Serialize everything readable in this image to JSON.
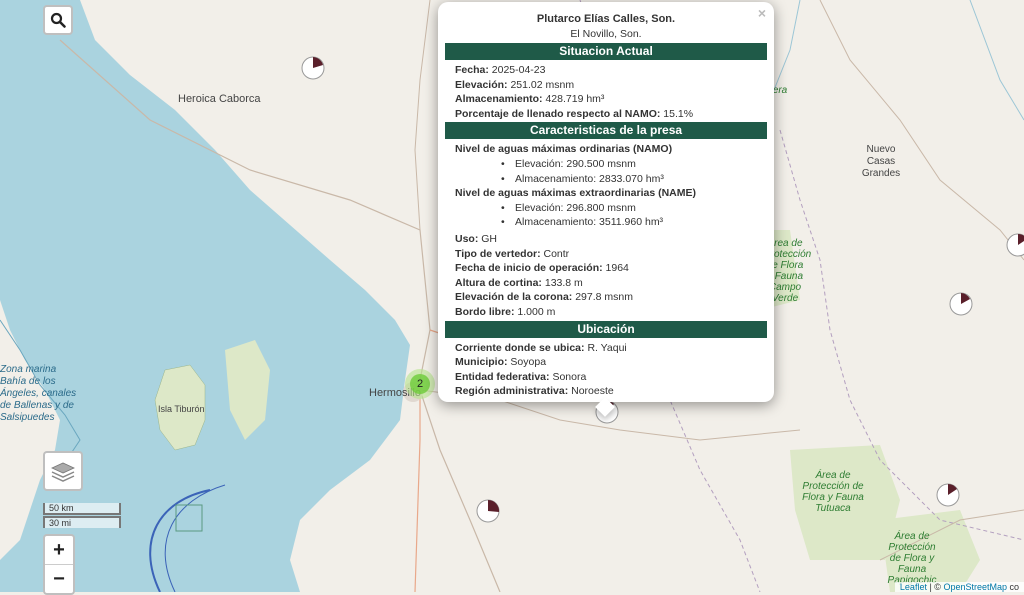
{
  "map": {
    "places": {
      "caborca": "Heroica Caborca",
      "hermosillo": "Hermosillo",
      "isla_tiburon": "Isla Tiburón",
      "nuevo_casas_grandes": "Nuevo Casas Grandes",
      "sea_area": "Zona marina Bahía de los Ángeles, canales de Ballenas y de Salsipuedes",
      "area_protegida_1": "Área de Protección de Flora y Fauna Campo Verde",
      "area_protegida_2": "Área de Protección de Flora y Fauna Tutuaca",
      "area_protegida_3": "Área de Protección de Flora y Fauna Papigochic",
      "partial_label": "fera"
    },
    "cluster_count": "2",
    "scale_km": "50 km",
    "scale_mi": "30 mi",
    "zoom_in": "+",
    "zoom_out": "−",
    "attribution_leaflet": "Leaflet",
    "attribution_sep": " | © ",
    "attribution_osm": "OpenStreetMap",
    "attribution_tail": " co",
    "icons": [
      "search-icon",
      "layers-icon"
    ],
    "colors": {
      "water": "#aad3df",
      "land": "#f2efe9",
      "protected": "#dde8c8",
      "header_band": "#1f5a48",
      "cluster": "#6ecc39"
    }
  },
  "popup": {
    "close": "×",
    "title": "Plutarco Elías Calles, Son.",
    "subtitle": "El Novillo, Son.",
    "section_actual": "Situacion Actual",
    "actual": {
      "fecha_label": "Fecha:",
      "fecha": " 2025-04-23",
      "elev_label": "Elevación:",
      "elev": " 251.02 msnm",
      "alm_label": "Almacenamiento:",
      "alm": " 428.719 hm³",
      "pct_label": "Porcentaje de llenado respecto al NAMO:",
      "pct": " 15.1%"
    },
    "section_carac": "Caracteristicas de la presa",
    "carac": {
      "namo_label": "Nivel de aguas máximas ordinarias (NAMO)",
      "namo_elev": "Elevación: 290.500 msnm",
      "namo_alm": "Almacenamiento: 2833.070 hm³",
      "name_label": "Nivel de aguas máximas extraordinarias (NAME)",
      "name_elev": "Elevación: 296.800 msnm",
      "name_alm": "Almacenamiento: 3511.960 hm³",
      "uso_label": "Uso:",
      "uso": " GH",
      "vert_label": "Tipo de vertedor:",
      "vert": " Contr",
      "fecha_op_label": "Fecha de inicio de operación:",
      "fecha_op": " 1964",
      "altura_label": "Altura de cortina:",
      "altura": " 133.8 m",
      "corona_label": "Elevación de la corona:",
      "corona": " 297.8 msnm",
      "bordo_label": "Bordo libre:",
      "bordo": " 1.000 m"
    },
    "section_ubic": "Ubicación",
    "ubic": {
      "corriente_label": "Corriente donde se ubica:",
      "corriente": " R. Yaqui",
      "mun_label": "Municipio:",
      "mun": " Soyopa",
      "ent_label": "Entidad federativa:",
      "ent": " Sonora",
      "reg_label": "Región administrativa:",
      "reg": " Noroeste"
    }
  }
}
